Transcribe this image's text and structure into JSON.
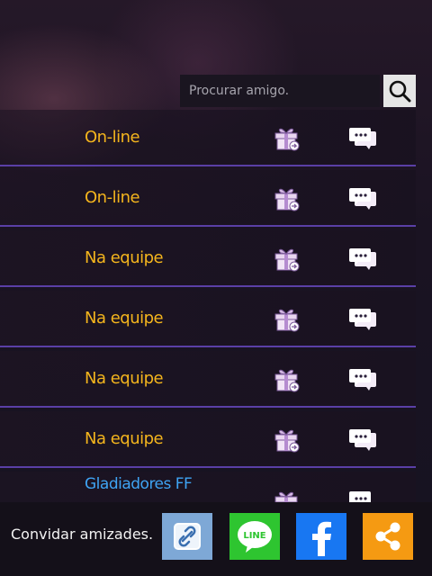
{
  "search": {
    "placeholder": "Procurar amigo."
  },
  "friends": [
    {
      "status": "On-line"
    },
    {
      "status": "On-line"
    },
    {
      "status": "Na equipe"
    },
    {
      "status": "Na equipe"
    },
    {
      "status": "Na equipe"
    },
    {
      "status": "Na equipe"
    },
    {
      "status": "Gladiadores FF"
    }
  ],
  "footer": {
    "invite_label": "Convidar amizades."
  },
  "icons": {
    "search": "search-icon",
    "gift": "gift-icon",
    "chat": "chat-icon",
    "link": "link-icon",
    "line": "line-icon",
    "facebook": "facebook-icon",
    "share": "share-icon"
  },
  "colors": {
    "status_online": "#f4b51d",
    "status_guild": "#3fa4f4",
    "row_divider": "#5a3fa6",
    "line_green": "#2ec530",
    "facebook_blue": "#1877f2",
    "share_orange": "#f59a12",
    "link_blue": "#7ea8d6"
  }
}
